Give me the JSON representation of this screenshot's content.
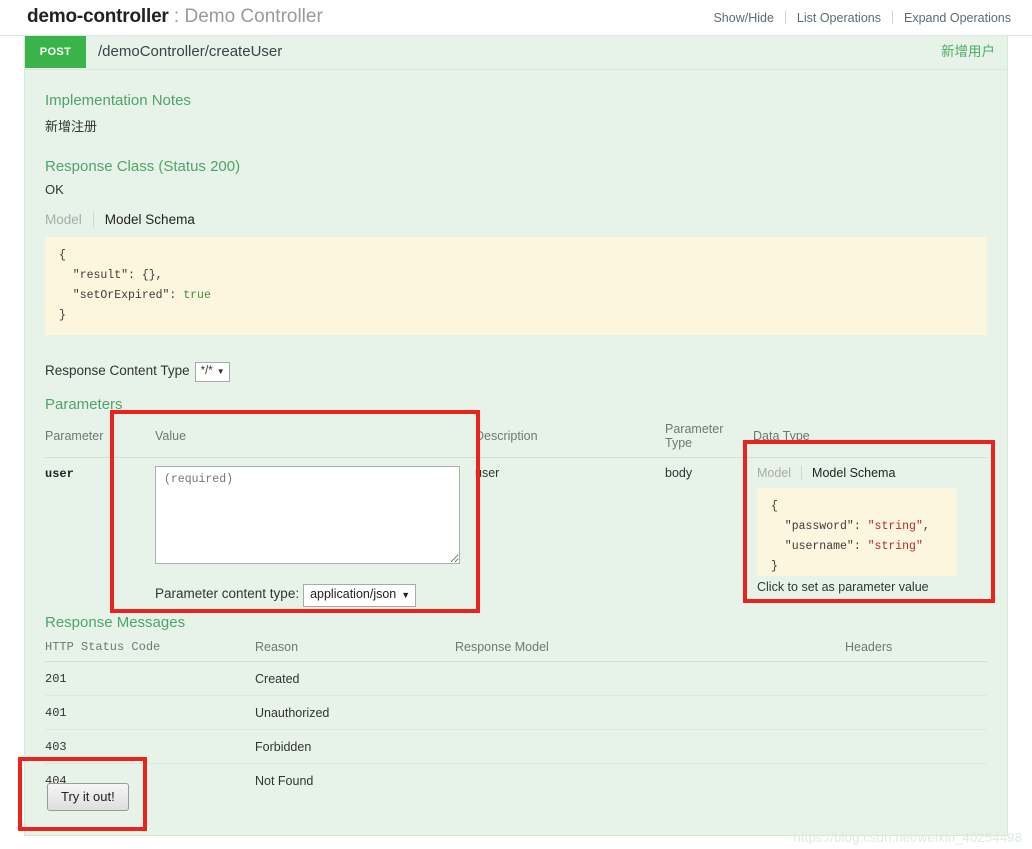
{
  "resource": {
    "name": "demo-controller",
    "separator": ":",
    "description": "Demo Controller",
    "links": [
      {
        "label": "Show/Hide"
      },
      {
        "label": "List Operations"
      },
      {
        "label": "Expand Operations"
      }
    ]
  },
  "operation": {
    "method": "POST",
    "path": "/demoController/createUser",
    "summary": "新增用户"
  },
  "implementation_notes": {
    "heading": "Implementation Notes",
    "body": "新增注册"
  },
  "response_class": {
    "heading": "Response Class (Status 200)",
    "status_text": "OK",
    "tabs": [
      {
        "label": "Model",
        "active": false
      },
      {
        "label": "Model Schema",
        "active": true
      }
    ],
    "schema_code": {
      "line1": "{",
      "line2_key": "  \"result\"",
      "line2_rest": ": {},",
      "line3_key": "  \"setOrExpired\"",
      "line3_sep": ": ",
      "line3_val": "true",
      "line4": "}"
    }
  },
  "response_content_type": {
    "label": "Response Content Type",
    "value": "*/*",
    "caret": "▼"
  },
  "parameters": {
    "heading": "Parameters",
    "columns": [
      "Parameter",
      "Value",
      "Description",
      "Parameter Type",
      "Data Type"
    ],
    "rows": [
      {
        "parameter": "user",
        "value_placeholder": "(required)",
        "value": "",
        "description": "user",
        "parameter_type": "body",
        "content_type_label": "Parameter content type:",
        "content_type_value": "application/json",
        "caret": "▼",
        "data_type_tabs": [
          {
            "label": "Model",
            "active": false
          },
          {
            "label": "Model Schema",
            "active": true
          }
        ],
        "data_type_code": {
          "line1": "{",
          "line2_key": "  \"password\"",
          "line2_sep": ": ",
          "line2_val": "\"string\"",
          "line2_end": ",",
          "line3_key": "  \"username\"",
          "line3_sep": ": ",
          "line3_val": "\"string\"",
          "line4": "}"
        },
        "click_hint": "Click to set as parameter value"
      }
    ]
  },
  "response_messages": {
    "heading": "Response Messages",
    "columns": [
      "HTTP Status Code",
      "Reason",
      "Response Model",
      "Headers"
    ],
    "rows": [
      {
        "code": "201",
        "reason": "Created",
        "model": "",
        "headers": ""
      },
      {
        "code": "401",
        "reason": "Unauthorized",
        "model": "",
        "headers": ""
      },
      {
        "code": "403",
        "reason": "Forbidden",
        "model": "",
        "headers": ""
      },
      {
        "code": "404",
        "reason": "Not Found",
        "model": "",
        "headers": ""
      }
    ]
  },
  "try_button": {
    "label": "Try it out!"
  },
  "watermark": {
    "text": "https://blog.csdn.net/weixin_40254498"
  },
  "colors": {
    "method_post": "#39b34a",
    "panel_bg": "#e7f3e9",
    "heading_green": "#4ea468",
    "code_bg": "#fcf6df",
    "annotation_red": "#e8241c"
  }
}
